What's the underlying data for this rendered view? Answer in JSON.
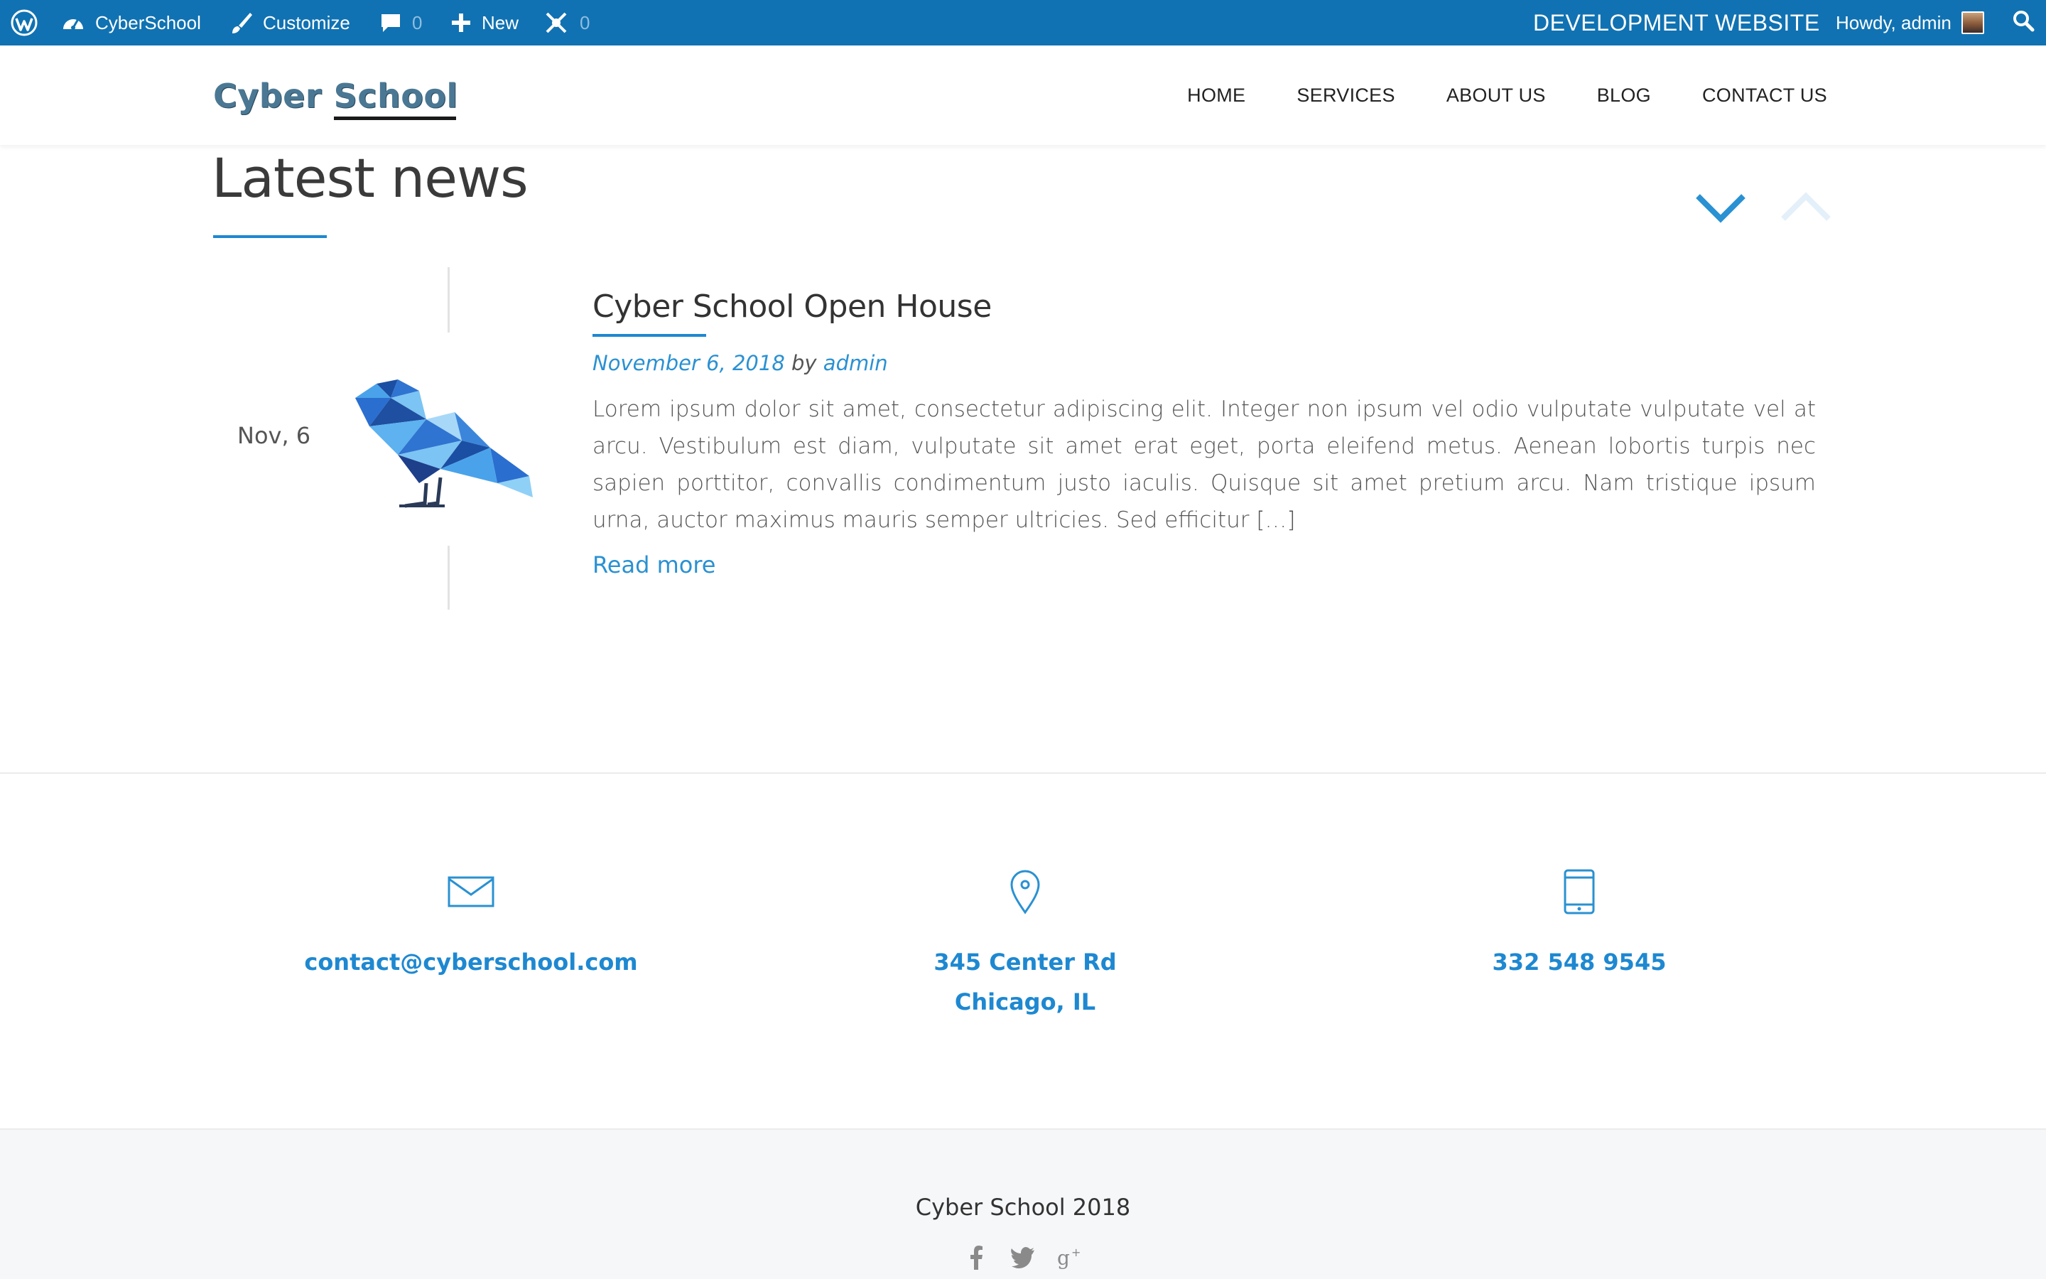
{
  "admin_bar": {
    "site_name": "CyberSchool",
    "customize": "Customize",
    "comments_count": "0",
    "new_label": "New",
    "plugin_count": "0",
    "environment": "DEVELOPMENT WEBSITE",
    "greeting": "Howdy, admin",
    "icons": [
      "wordpress-icon",
      "dashboard-icon",
      "brush-icon",
      "comment-icon",
      "plus-icon",
      "plugin-icon",
      "search-icon"
    ]
  },
  "header": {
    "logo_text": "Cyber School",
    "nav": [
      "HOME",
      "SERVICES",
      "ABOUT US",
      "BLOG",
      "CONTACT US"
    ]
  },
  "news": {
    "section_title": "Latest news",
    "post": {
      "date_badge": "Nov, 6",
      "title": "Cyber School Open House",
      "meta_date": "November 6, 2018",
      "meta_by": "by",
      "meta_author": "admin",
      "excerpt": "Lorem ipsum dolor sit amet, consectetur adipiscing elit. Integer non ipsum vel odio vulputate vulputate vel at arcu. Vestibulum est diam, vulputate sit amet erat eget, porta eleifend metus. Aenean lobortis turpis nec sapien porttitor, convallis condimentum justo iaculis. Quisque sit amet pretium arcu. Nam tristique ipsum urna, auctor maximus mauris semper ultricies. Sed efficitur […]",
      "read_more": "Read more"
    }
  },
  "contact": {
    "email": "contact@cyberschool.com",
    "address_line1": "345 Center Rd",
    "address_line2": "Chicago, IL",
    "phone": "332 548 9545"
  },
  "footer": {
    "copyright": "Cyber School 2018",
    "social_icons": [
      "facebook-icon",
      "twitter-icon",
      "google-plus-icon"
    ]
  },
  "colors": {
    "admin_bar": "#1072b2",
    "accent": "#1e88d1",
    "footer_bg": "#f6f7f9"
  }
}
